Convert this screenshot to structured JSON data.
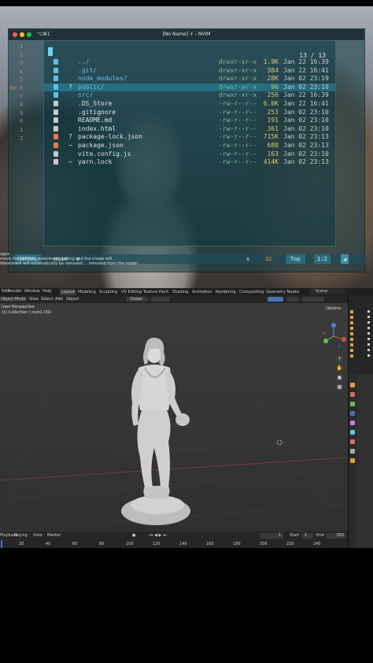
{
  "terminal": {
    "shortcut": "⌥⌘1",
    "title": "[No Name] + - NVIM",
    "gutter_numbers": [
      "1",
      "2",
      "3",
      "4",
      "5",
      "6",
      "7",
      "8",
      "9",
      "0",
      "1",
      "2"
    ],
    "gutter_labels": [
      "Re"
    ],
    "explorer": {
      "pager": "13 / 13",
      "rows": [
        {
          "mark": "",
          "name": "../",
          "perm": "drwxr-xr-x",
          "size": "1.9K",
          "date": "Jan 22 16:39",
          "kind": "dir"
        },
        {
          "mark": "",
          "name": ".git/",
          "perm": "drwxr-xr-x",
          "size": "384",
          "date": "Jan 22 16:41",
          "kind": "dir"
        },
        {
          "mark": "",
          "name": "node_modules/",
          "perm": "drwxr-xr-x",
          "size": "28K",
          "date": "Jan 02 23:19",
          "kind": "dir"
        },
        {
          "mark": "?",
          "name": "public/",
          "perm": "drwxr-xr-x",
          "size": "96",
          "date": "Jan 02 23:10",
          "kind": "dir",
          "selected": true
        },
        {
          "mark": "",
          "name": "src/",
          "perm": "drwxr-xr-x",
          "size": "256",
          "date": "Jan 22 16:39",
          "kind": "dir"
        },
        {
          "mark": "",
          "name": ".DS_Store",
          "perm": "-rw-r--r--",
          "size": "6.0K",
          "date": "Jan 22 16:41",
          "kind": "file"
        },
        {
          "mark": "",
          "name": ".gitignore",
          "perm": "-rw-r--r--",
          "size": "253",
          "date": "Jan 02 23:10",
          "kind": "file"
        },
        {
          "mark": "",
          "name": "README.md",
          "perm": "-rw-r--r--",
          "size": "191",
          "date": "Jan 02 23:10",
          "kind": "file"
        },
        {
          "mark": "",
          "name": "index.html",
          "perm": "-rw-r--r--",
          "size": "361",
          "date": "Jan 02 23:10",
          "kind": "file"
        },
        {
          "mark": "?",
          "name": "package-lock.json",
          "perm": "-rw-r--r--",
          "size": "715K",
          "date": "Jan 02 23:13",
          "kind": "file"
        },
        {
          "mark": "~",
          "name": "package.json",
          "perm": "-rw-r--r--",
          "size": "688",
          "date": "Jan 02 23:13",
          "kind": "file"
        },
        {
          "mark": "",
          "name": "vite.config.js",
          "perm": "-rw-r--r--",
          "size": "163",
          "date": "Jan 02 23:10",
          "kind": "file"
        },
        {
          "mark": "~",
          "name": "yarn.lock",
          "perm": "-rw-r--r--",
          "size": "414K",
          "date": "Jan 02 23:13",
          "kind": "file"
        }
      ]
    },
    "statusline": {
      "mode": "NORMAL",
      "branch": "main",
      "separator": "≡",
      "filetype": "s",
      "warnings": "32",
      "position": "Top",
      "line": "1:2"
    },
    "overlay_lines": [
      "ages",
      "move the 'remove watermark' setting and the image will ...",
      "Watermark will automatically be removed ... removed from the model"
    ]
  },
  "blender": {
    "topbar": {
      "menus": [
        "Edit",
        "Render",
        "Window",
        "Help"
      ],
      "workspaces": [
        "Layout",
        "Modeling",
        "Sculpting",
        "UV Editing",
        "Texture Paint",
        "Shading",
        "Animation",
        "Rendering",
        "Compositing",
        "Geometry Nodes"
      ],
      "active_workspace": "Layout",
      "scene": "Scene"
    },
    "header": {
      "mode": "Object Mode",
      "menus": [
        "View",
        "Select",
        "Add",
        "Object"
      ],
      "orientation": "Global"
    },
    "viewport": {
      "perspective": "User Perspective",
      "collection": "(1) Collection | rock1.002",
      "options": "Options"
    },
    "timeline": {
      "menus": [
        "Playback",
        "Keying",
        "View",
        "Marker"
      ],
      "current_frame": "1",
      "start_label": "Start",
      "start": "1",
      "end_label": "End",
      "end": "250",
      "ticks": [
        "20",
        "40",
        "60",
        "80",
        "100",
        "120",
        "140",
        "160",
        "180",
        "200",
        "220",
        "240"
      ]
    },
    "colors": {
      "accent": "#4772b3",
      "selected_row": "#288caa",
      "warning": "#ff8a4a",
      "outliner_icon": "#e0a140"
    }
  }
}
